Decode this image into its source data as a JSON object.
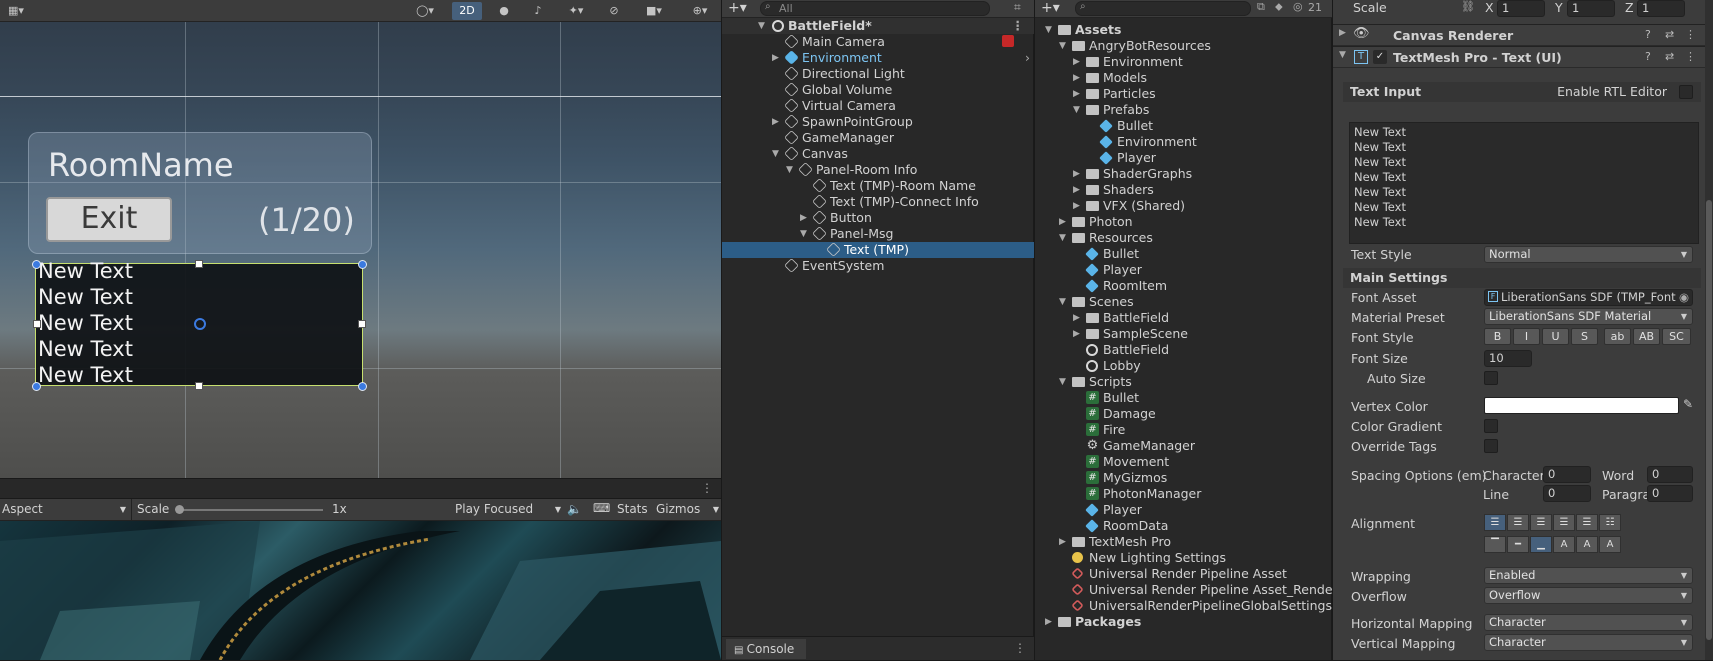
{
  "scene_view": {
    "toolbar": {
      "mode_2d": "2D"
    },
    "room_name": "RoomName",
    "exit_button": "Exit",
    "player_count": "(1/20)",
    "msg_lines": [
      "New Text",
      "New Text",
      "New Text",
      "New Text",
      "New Text"
    ]
  },
  "game_view": {
    "aspect": "Aspect",
    "scale_label": "Scale",
    "scale_value": "1x",
    "play_mode": "Play Focused",
    "stats": "Stats",
    "gizmos": "Gizmos"
  },
  "hierarchy": {
    "search_placeholder": "All",
    "scene": "BattleField*",
    "items": [
      {
        "label": "Main Camera"
      },
      {
        "label": "Environment"
      },
      {
        "label": "Directional Light"
      },
      {
        "label": "Global Volume"
      },
      {
        "label": "Virtual Camera"
      },
      {
        "label": "SpawnPointGroup"
      },
      {
        "label": "GameManager"
      },
      {
        "label": "Canvas"
      },
      {
        "label": "Panel-Room Info"
      },
      {
        "label": "Text (TMP)-Room Name"
      },
      {
        "label": "Text (TMP)-Connect Info"
      },
      {
        "label": "Button"
      },
      {
        "label": "Panel-Msg"
      },
      {
        "label": "Text (TMP)"
      },
      {
        "label": "EventSystem"
      }
    ],
    "console_tab": "Console"
  },
  "project": {
    "hidden_count": "21",
    "items": [
      {
        "label": "Assets"
      },
      {
        "label": "AngryBotResources"
      },
      {
        "label": "Environment"
      },
      {
        "label": "Models"
      },
      {
        "label": "Particles"
      },
      {
        "label": "Prefabs"
      },
      {
        "label": "Bullet"
      },
      {
        "label": "Environment"
      },
      {
        "label": "Player"
      },
      {
        "label": "ShaderGraphs"
      },
      {
        "label": "Shaders"
      },
      {
        "label": "VFX (Shared)"
      },
      {
        "label": "Photon"
      },
      {
        "label": "Resources"
      },
      {
        "label": "Bullet"
      },
      {
        "label": "Player"
      },
      {
        "label": "RoomItem"
      },
      {
        "label": "Scenes"
      },
      {
        "label": "BattleField"
      },
      {
        "label": "SampleScene"
      },
      {
        "label": "BattleField"
      },
      {
        "label": "Lobby"
      },
      {
        "label": "Scripts"
      },
      {
        "label": "Bullet"
      },
      {
        "label": "Damage"
      },
      {
        "label": "Fire"
      },
      {
        "label": "GameManager"
      },
      {
        "label": "Movement"
      },
      {
        "label": "MyGizmos"
      },
      {
        "label": "PhotonManager"
      },
      {
        "label": "Player"
      },
      {
        "label": "RoomData"
      },
      {
        "label": "TextMesh Pro"
      },
      {
        "label": "New Lighting Settings"
      },
      {
        "label": "Universal Render Pipeline Asset"
      },
      {
        "label": "Universal Render Pipeline Asset_Renderer"
      },
      {
        "label": "UniversalRenderPipelineGlobalSettings"
      },
      {
        "label": "Packages"
      }
    ]
  },
  "inspector": {
    "scale_label": "Scale",
    "scale_x": "1",
    "scale_y": "1",
    "scale_z": "1",
    "x": "X",
    "y": "Y",
    "z": "Z",
    "canvas_renderer": "Canvas Renderer",
    "tmp_component": "TextMesh Pro - Text (UI)",
    "text_input": "Text Input",
    "enable_rtl": "Enable RTL Editor",
    "text_lines": [
      "New Text",
      "New Text",
      "New Text",
      "New Text",
      "New Text",
      "New Text",
      "New Text"
    ],
    "text_style_label": "Text Style",
    "text_style": "Normal",
    "main_settings": "Main Settings",
    "font_asset_label": "Font Asset",
    "font_asset": "LiberationSans SDF (TMP_Font",
    "material_preset_label": "Material Preset",
    "material_preset": "LiberationSans SDF Material",
    "font_style_label": "Font Style",
    "font_style_buttons": [
      "B",
      "I",
      "U",
      "S",
      "ab",
      "AB",
      "SC"
    ],
    "font_size_label": "Font Size",
    "font_size": "10",
    "auto_size_label": "Auto Size",
    "vertex_color_label": "Vertex Color",
    "vertex_color": "#ffffff",
    "color_gradient_label": "Color Gradient",
    "override_tags_label": "Override Tags",
    "spacing_label": "Spacing Options (em)",
    "character_label": "Character",
    "character": "0",
    "word_label": "Word",
    "word": "0",
    "line_label": "Line",
    "line": "0",
    "paragraph_label": "Paragraph",
    "paragraph": "0",
    "alignment_label": "Alignment",
    "wrapping_label": "Wrapping",
    "wrapping": "Enabled",
    "overflow_label": "Overflow",
    "overflow": "Overflow",
    "hmap_label": "Horizontal Mapping",
    "hmap": "Character",
    "vmap_label": "Vertical Mapping",
    "vmap": "Character"
  }
}
